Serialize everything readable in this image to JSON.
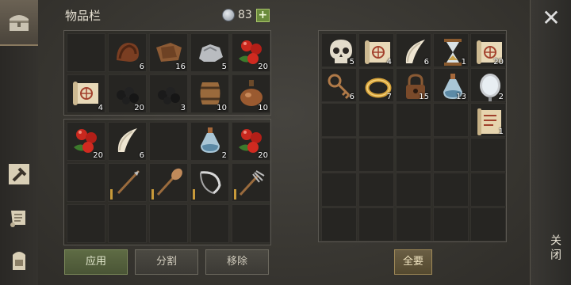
{
  "header": {
    "title": "物品栏",
    "coins": "83",
    "plus": "+"
  },
  "close": {
    "icon": "✕",
    "label": "关闭"
  },
  "sidebar": {
    "tabs": [
      {
        "icon": "chest-icon"
      },
      {
        "icon": "crafting-icon"
      },
      {
        "icon": "scroll-icon"
      },
      {
        "icon": "backpack-icon"
      }
    ]
  },
  "left": {
    "grid_a": [
      {
        "icon": "empty"
      },
      {
        "icon": "leather-icon",
        "count": "6"
      },
      {
        "icon": "hide-icon",
        "count": "16"
      },
      {
        "icon": "stone-icon",
        "count": "5"
      },
      {
        "icon": "berries-icon",
        "count": "20"
      },
      {
        "icon": "map-scroll-icon",
        "count": "4"
      },
      {
        "icon": "coal-icon",
        "count": "20"
      },
      {
        "icon": "coal-icon",
        "count": "3"
      },
      {
        "icon": "barrel-icon",
        "count": "10"
      },
      {
        "icon": "flask-icon",
        "count": "10"
      }
    ],
    "grid_b": [
      {
        "icon": "berries-icon",
        "count": "20"
      },
      {
        "icon": "fang-icon",
        "count": "6"
      },
      {
        "icon": "empty"
      },
      {
        "icon": "potion-icon",
        "count": "2"
      },
      {
        "icon": "berries-icon",
        "count": "20"
      },
      {
        "icon": "empty"
      },
      {
        "icon": "spear-icon",
        "tool": true
      },
      {
        "icon": "shovel-icon",
        "tool": true
      },
      {
        "icon": "sickle-icon",
        "tool": true
      },
      {
        "icon": "pitchfork-icon",
        "tool": true
      },
      {
        "icon": "empty"
      },
      {
        "icon": "empty"
      },
      {
        "icon": "empty"
      },
      {
        "icon": "empty"
      },
      {
        "icon": "empty"
      }
    ],
    "buttons": {
      "apply": "应用",
      "split": "分割",
      "remove": "移除"
    }
  },
  "right": {
    "grid": [
      {
        "icon": "skull-icon",
        "count": "5"
      },
      {
        "icon": "map-scroll-icon",
        "count": "4"
      },
      {
        "icon": "fang-icon",
        "count": "6"
      },
      {
        "icon": "hourglass-icon",
        "count": "1"
      },
      {
        "icon": "map-scroll-icon",
        "count": "20"
      },
      {
        "icon": "key-icon",
        "count": "6"
      },
      {
        "icon": "ring-icon",
        "count": "7"
      },
      {
        "icon": "padlock-icon",
        "count": "15"
      },
      {
        "icon": "potion-icon",
        "count": "13"
      },
      {
        "icon": "mirror-icon",
        "count": "2"
      },
      {
        "icon": "empty"
      },
      {
        "icon": "empty"
      },
      {
        "icon": "empty"
      },
      {
        "icon": "empty"
      },
      {
        "icon": "rune-scroll-icon",
        "count": "1"
      },
      {
        "icon": "empty"
      },
      {
        "icon": "empty"
      },
      {
        "icon": "empty"
      },
      {
        "icon": "empty"
      },
      {
        "icon": "empty"
      },
      {
        "icon": "empty"
      },
      {
        "icon": "empty"
      },
      {
        "icon": "empty"
      },
      {
        "icon": "empty"
      },
      {
        "icon": "empty"
      },
      {
        "icon": "empty"
      },
      {
        "icon": "empty"
      },
      {
        "icon": "empty"
      },
      {
        "icon": "empty"
      },
      {
        "icon": "empty"
      }
    ],
    "buttons": {
      "all": "全要"
    }
  }
}
